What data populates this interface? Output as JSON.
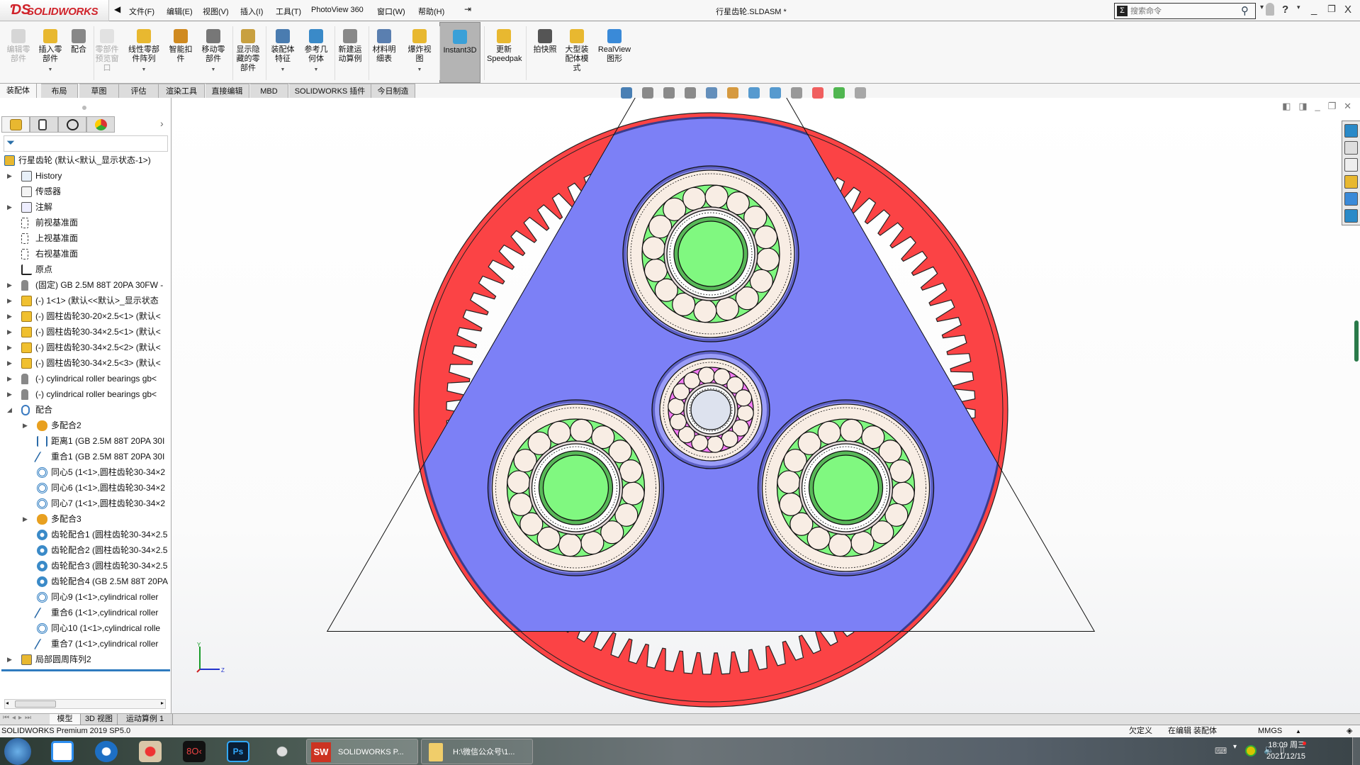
{
  "app": {
    "brand": "SOLIDWORKS",
    "title": "行星齿轮.SLDASM *"
  },
  "menu": [
    "文件(F)",
    "编辑(E)",
    "视图(V)",
    "插入(I)",
    "工具(T)",
    "PhotoView 360",
    "窗口(W)",
    "帮助(H)"
  ],
  "search": {
    "placeholder": "搜索命令"
  },
  "ribbon": [
    {
      "label": "编辑零\n部件",
      "icon": "edit-component-icon",
      "disabled": true
    },
    {
      "label": "插入零\n部件",
      "icon": "insert-components-icon",
      "dropdown": true
    },
    {
      "label": "配合",
      "icon": "mate-paperclip-icon"
    },
    {
      "label": "零部件\n预览窗\n口",
      "icon": "component-preview-icon",
      "disabled": true
    },
    {
      "label": "线性零部\n件阵列",
      "icon": "linear-pattern-icon",
      "dropdown": true
    },
    {
      "label": "智能扣\n件",
      "icon": "smart-fasteners-icon"
    },
    {
      "label": "移动零\n部件",
      "icon": "move-component-icon",
      "dropdown": true
    },
    {
      "label": "显示隐\n藏的零\n部件",
      "icon": "show-hidden-icon"
    },
    {
      "label": "装配体\n特征",
      "icon": "assembly-features-icon",
      "dropdown": true
    },
    {
      "label": "参考几\n何体",
      "icon": "reference-geometry-icon",
      "dropdown": true
    },
    {
      "label": "新建运\n动算例",
      "icon": "new-motion-study-icon"
    },
    {
      "label": "材料明\n细表",
      "icon": "bill-of-materials-icon"
    },
    {
      "label": "爆炸视\n图",
      "icon": "exploded-view-icon",
      "dropdown": true
    },
    {
      "label": "Instant3D",
      "icon": "instant3d-icon",
      "selected": true
    },
    {
      "label": "更新\nSpeedpak",
      "icon": "speedpak-icon"
    },
    {
      "label": "拍快照",
      "icon": "camera-icon"
    },
    {
      "label": "大型装\n配体模\n式",
      "icon": "large-assembly-icon"
    },
    {
      "label": "RealView\n图形",
      "icon": "realview-sphere-icon"
    }
  ],
  "tabs": [
    "装配体",
    "布局",
    "草图",
    "评估",
    "渲染工具",
    "直接编辑",
    "MBD",
    "SOLIDWORKS 插件",
    "今日制造"
  ],
  "active_tab": "装配体",
  "tree": [
    {
      "level": 0,
      "arrow": "",
      "icon": "assembly-icon",
      "label": "行星齿轮  (默认<默认_显示状态-1>)"
    },
    {
      "level": 1,
      "arrow": "right",
      "icon": "history-folder-icon",
      "label": "History"
    },
    {
      "level": 1,
      "arrow": "",
      "icon": "sensors-folder-icon",
      "label": "传感器"
    },
    {
      "level": 1,
      "arrow": "right",
      "icon": "annotations-folder-icon",
      "label": "注解"
    },
    {
      "level": 1,
      "arrow": "",
      "icon": "plane-icon",
      "label": "前视基准面"
    },
    {
      "level": 1,
      "arrow": "",
      "icon": "plane-icon",
      "label": "上视基准面"
    },
    {
      "level": 1,
      "arrow": "",
      "icon": "plane-icon",
      "label": "右视基准面"
    },
    {
      "level": 1,
      "arrow": "",
      "icon": "origin-icon",
      "label": "原点"
    },
    {
      "level": 1,
      "arrow": "right",
      "icon": "toolbox-part-icon",
      "label": "(固定) GB 2.5M 88T 20PA 30FW -"
    },
    {
      "level": 1,
      "arrow": "right",
      "icon": "subassembly-icon",
      "label": "(-) 1<1> (默认<<默认>_显示状态"
    },
    {
      "level": 1,
      "arrow": "right",
      "icon": "subassembly-icon",
      "label": "(-) 圆柱齿轮30-20×2.5<1> (默认<"
    },
    {
      "level": 1,
      "arrow": "right",
      "icon": "subassembly-icon",
      "label": "(-) 圆柱齿轮30-34×2.5<1> (默认<"
    },
    {
      "level": 1,
      "arrow": "right",
      "icon": "subassembly-icon",
      "label": "(-) 圆柱齿轮30-34×2.5<2> (默认<"
    },
    {
      "level": 1,
      "arrow": "right",
      "icon": "subassembly-icon",
      "label": "(-) 圆柱齿轮30-34×2.5<3> (默认<"
    },
    {
      "level": 1,
      "arrow": "right",
      "icon": "toolbox-part-icon",
      "label": "(-) cylindrical roller bearings gb<"
    },
    {
      "level": 1,
      "arrow": "right",
      "icon": "toolbox-part-icon",
      "label": "(-) cylindrical roller bearings gb<"
    },
    {
      "level": 1,
      "arrow": "down",
      "icon": "mates-folder-icon",
      "label": "配合"
    },
    {
      "level": 2,
      "arrow": "right",
      "icon": "multimate-icon",
      "label": "多配合2"
    },
    {
      "level": 2,
      "arrow": "",
      "icon": "distance-mate-icon",
      "label": "距离1 (GB 2.5M 88T 20PA 30I"
    },
    {
      "level": 2,
      "arrow": "",
      "icon": "coincident-mate-icon",
      "label": "重合1 (GB 2.5M 88T 20PA 30I"
    },
    {
      "level": 2,
      "arrow": "",
      "icon": "concentric-mate-icon",
      "label": "同心5 (1<1>,圆柱齿轮30-34×2"
    },
    {
      "level": 2,
      "arrow": "",
      "icon": "concentric-mate-icon",
      "label": "同心6 (1<1>,圆柱齿轮30-34×2"
    },
    {
      "level": 2,
      "arrow": "",
      "icon": "concentric-mate-icon",
      "label": "同心7 (1<1>,圆柱齿轮30-34×2"
    },
    {
      "level": 2,
      "arrow": "right",
      "icon": "multimate-icon",
      "label": "多配合3"
    },
    {
      "level": 2,
      "arrow": "",
      "icon": "gear-mate-icon",
      "label": "齿轮配合1 (圆柱齿轮30-34×2.5"
    },
    {
      "level": 2,
      "arrow": "",
      "icon": "gear-mate-icon",
      "label": "齿轮配合2 (圆柱齿轮30-34×2.5"
    },
    {
      "level": 2,
      "arrow": "",
      "icon": "gear-mate-icon",
      "label": "齿轮配合3 (圆柱齿轮30-34×2.5"
    },
    {
      "level": 2,
      "arrow": "",
      "icon": "gear-mate-icon",
      "label": "齿轮配合4 (GB 2.5M 88T 20PA"
    },
    {
      "level": 2,
      "arrow": "",
      "icon": "concentric-mate-icon",
      "label": "同心9 (1<1>,cylindrical roller"
    },
    {
      "level": 2,
      "arrow": "",
      "icon": "coincident-mate-icon",
      "label": "重合6 (1<1>,cylindrical roller"
    },
    {
      "level": 2,
      "arrow": "",
      "icon": "concentric-mate-icon",
      "label": "同心10 (1<1>,cylindrical rolle"
    },
    {
      "level": 2,
      "arrow": "",
      "icon": "coincident-mate-icon",
      "label": "重合7 (1<1>,cylindrical roller"
    },
    {
      "level": 1,
      "arrow": "right",
      "icon": "circular-pattern-icon",
      "label": "局部圆周阵列2"
    }
  ],
  "hud_icons": [
    "view-orientation-icon",
    "zoom-to-fit-icon",
    "zoom-area-icon",
    "previous-view-icon",
    "section-view-icon",
    "dynamic-annotation-icon",
    "view-cube-icon",
    "display-style-icon",
    "hide-show-icon",
    "edit-appearance-icon",
    "apply-scene-icon",
    "view-settings-icon"
  ],
  "taskpane_icons": [
    "home-icon",
    "design-library-icon",
    "file-explorer-icon",
    "view-palette-icon",
    "appearances-icon",
    "custom-properties-icon"
  ],
  "bottom_tabs": [
    "模型",
    "3D 视图",
    "运动算例 1"
  ],
  "status": {
    "product": "SOLIDWORKS Premium 2019 SP5.0",
    "definition": "欠定义",
    "editing": "在编辑 装配体",
    "units": "MMGS"
  },
  "taskbar": {
    "tasks": [
      "SOLIDWORKS P...",
      "H:\\微信公众号\\1..."
    ],
    "time": "18:09 周三",
    "date": "2021/12/15"
  },
  "model": {
    "ring_teeth": 88,
    "colors": {
      "ring": "#fb4345",
      "carrier": "#7c80f6",
      "planet_hub": "#80f880",
      "sun_cage": "#f47cf4",
      "race": "#f8ede4",
      "sun_bore": "#dde2ee"
    }
  }
}
